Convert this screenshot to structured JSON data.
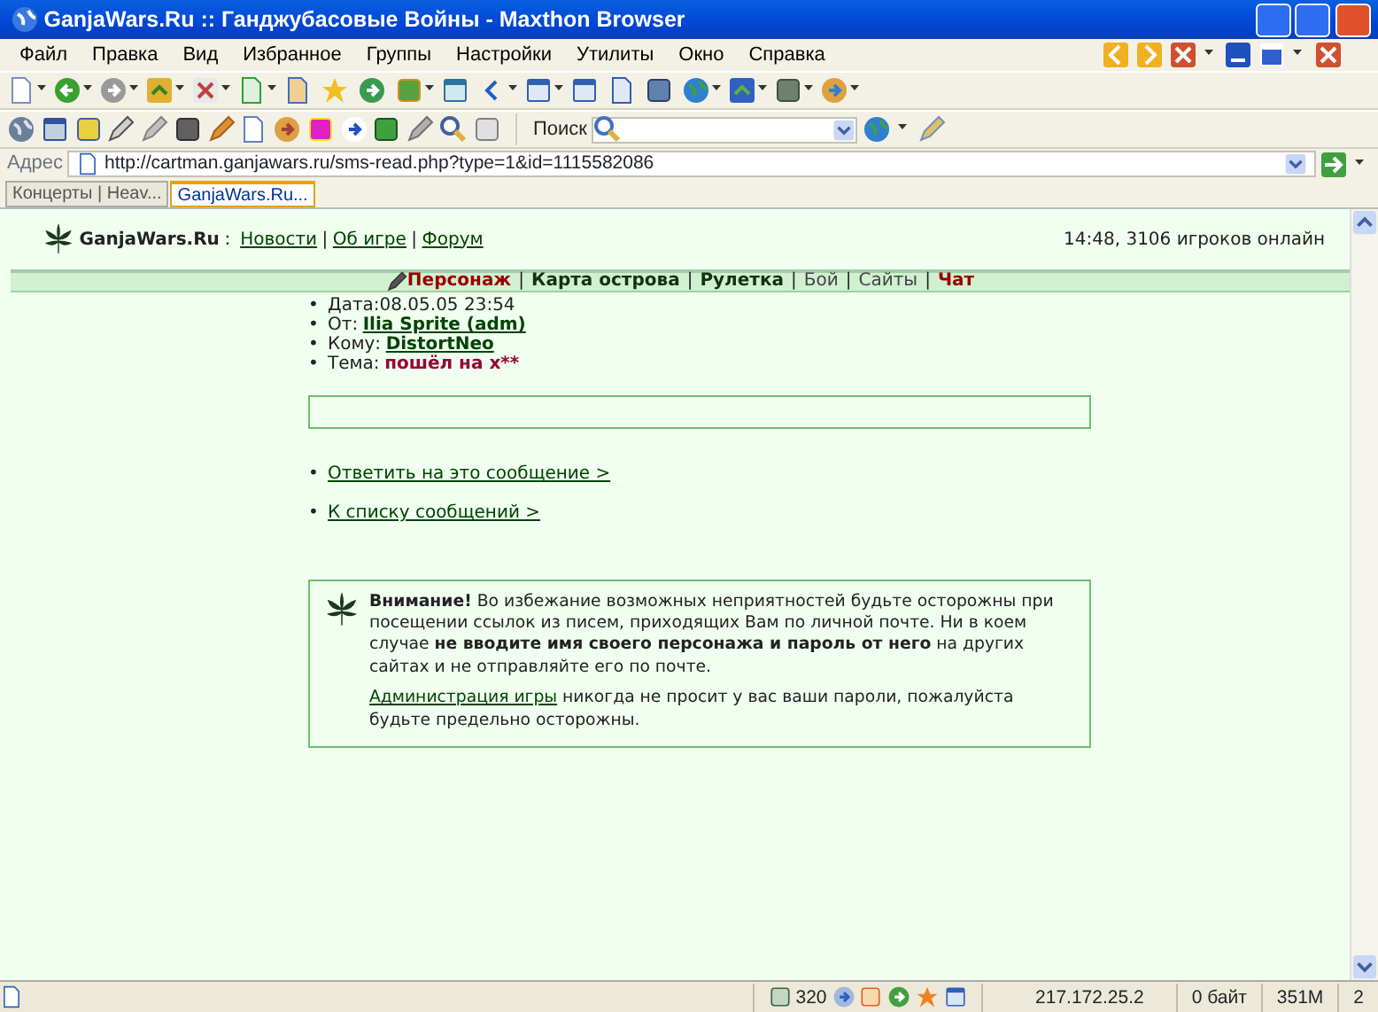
{
  "window": {
    "title": "GanjaWars.Ru :: Ганджубасовые Войны - Maxthon Browser"
  },
  "menu": [
    "Файл",
    "Правка",
    "Вид",
    "Избранное",
    "Группы",
    "Настройки",
    "Утилиты",
    "Окно",
    "Справка"
  ],
  "search": {
    "label": "Поиск"
  },
  "address": {
    "label": "Адрес",
    "value": "http://cartman.ganjawars.ru/sms-read.php?type=1&id=1115582086"
  },
  "tabs": [
    {
      "label": "Концерты | Heav...",
      "selected": false
    },
    {
      "label": "GanjaWars.Ru...",
      "selected": true
    }
  ],
  "page": {
    "site_name": "GanjaWars.Ru",
    "site_colon": ":",
    "top_links": [
      {
        "kind": "link",
        "text": "Новости"
      },
      {
        "kind": "separator",
        "text": "|"
      },
      {
        "kind": "link",
        "text": "Об игре"
      },
      {
        "kind": "separator",
        "text": "|"
      },
      {
        "kind": "link",
        "text": "Форум"
      }
    ],
    "online": "14:48, 3106 игроков онлайн",
    "nav": [
      {
        "kind": "alert",
        "text": "Персонаж"
      },
      {
        "kind": "separator",
        "text": "|"
      },
      {
        "kind": "bold",
        "text": "Карта острова"
      },
      {
        "kind": "separator",
        "text": "|"
      },
      {
        "kind": "bold",
        "text": "Рулетка"
      },
      {
        "kind": "separator",
        "text": "|"
      },
      {
        "kind": "plain",
        "text": "Бой"
      },
      {
        "kind": "separator",
        "text": "|"
      },
      {
        "kind": "plain",
        "text": "Сайты"
      },
      {
        "kind": "separator",
        "text": "|"
      },
      {
        "kind": "alert",
        "text": "Чат"
      }
    ],
    "message": [
      {
        "bullet": "•",
        "kind": "plain",
        "label": "Дата:",
        "value": "08.05.05 23:54"
      },
      {
        "bullet": "•",
        "kind": "link",
        "label": "От:",
        "value": "Ilia Sprite (adm)"
      },
      {
        "bullet": "•",
        "kind": "link",
        "label": "Кому:",
        "value": "DistortNeo"
      },
      {
        "bullet": "•",
        "kind": "subject",
        "label": "Тема:",
        "value": "пошёл на х**"
      }
    ],
    "actions": [
      {
        "bullet": "•",
        "text": "Ответить на это сообщение >"
      },
      {
        "bullet": "•",
        "text": "К списку сообщений >"
      }
    ],
    "warning": {
      "text": "**Внимание!** Во избежание возможных неприятностей будьте осторожны при посещении ссылок из писем, приходящих Вам по личной почте. Ни в коем случае **не вводите имя своего персонажа и пароль от него** на других сайтах и не отправляйте его по почте.",
      "link": "Администрация игры",
      "after_link": "никогда не просит у вас ваши пароли, пожалуйста будьте предельно осторожны."
    }
  },
  "status_bar": {
    "count": "320",
    "ip": "217.172.25.2",
    "traffic": "0 байт",
    "memory": "351M",
    "windows": "2"
  }
}
